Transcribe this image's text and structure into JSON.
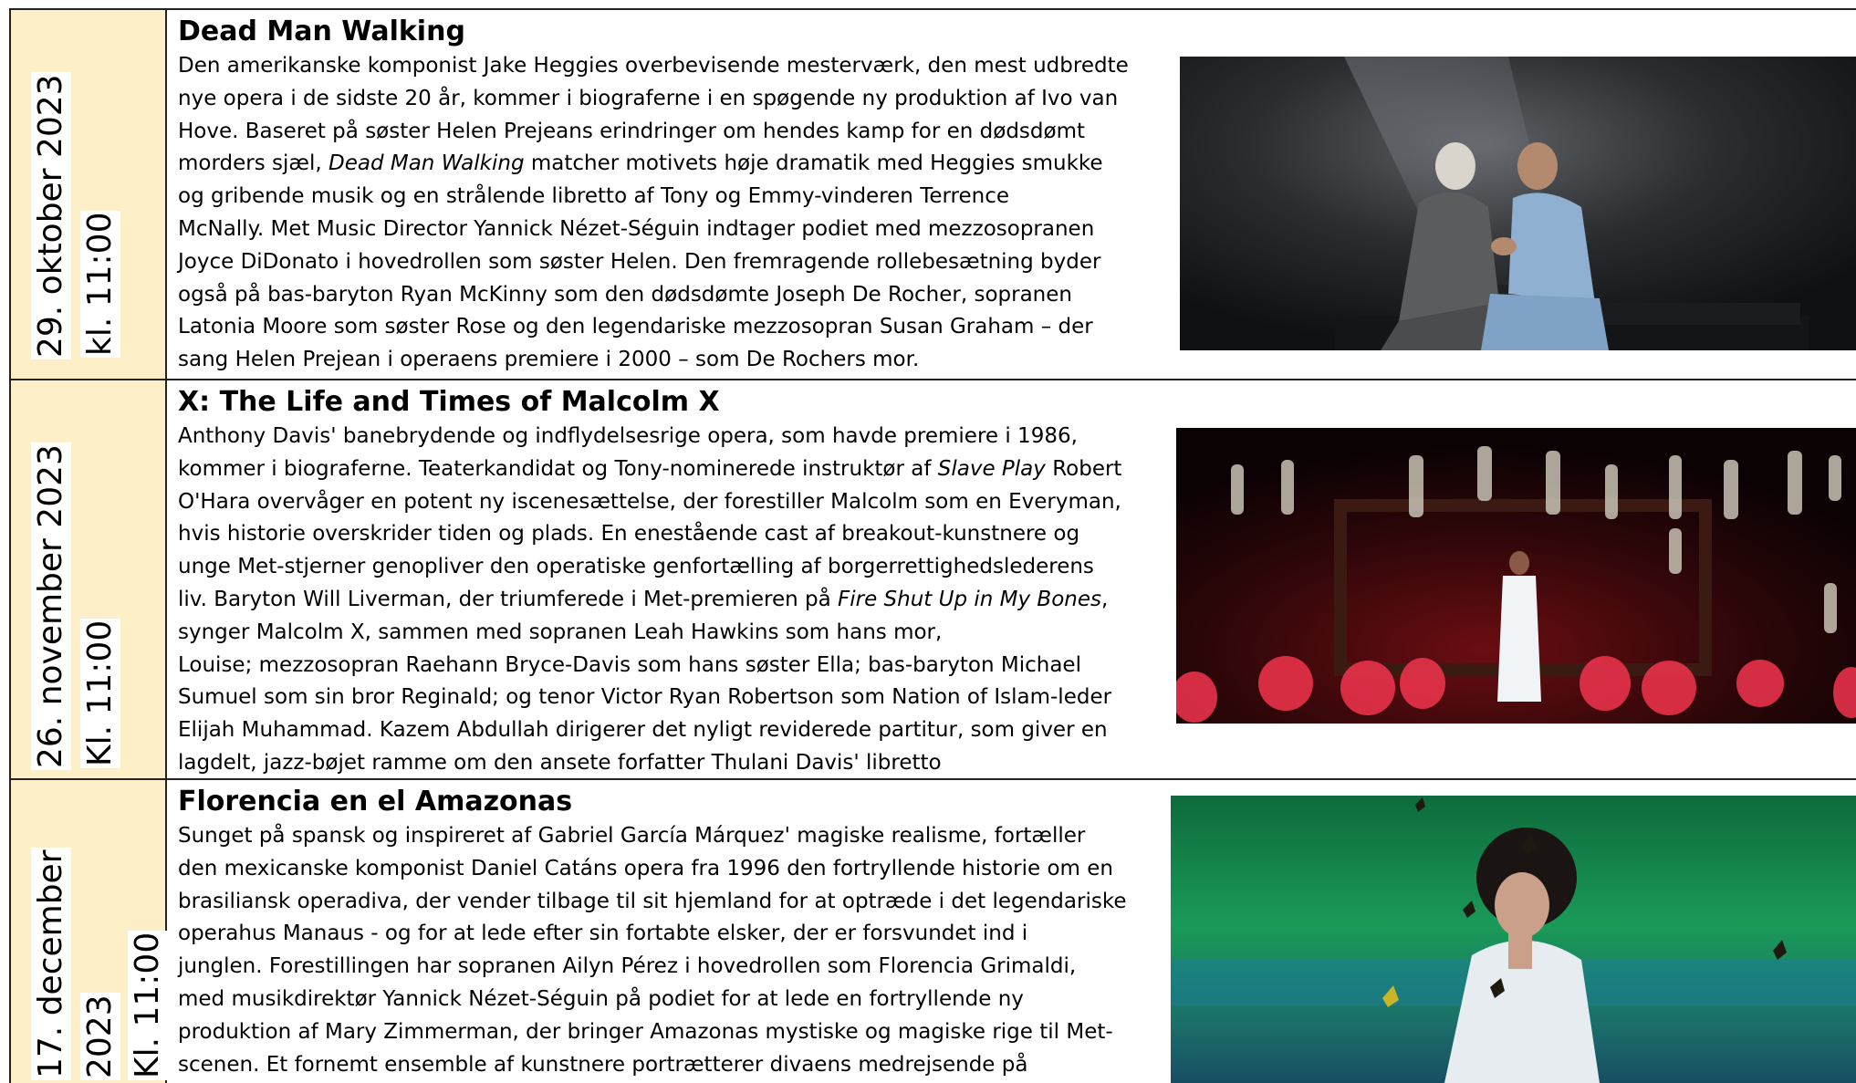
{
  "events": [
    {
      "date": "29. oktober  2023",
      "time": "kl. 11:00",
      "title": "Dead Man Walking",
      "description_lines": [
        "Den amerikanske komponist Jake Heggies overbevisende mesterværk, den mest udbredte",
        "nye opera i de sidste 20 år, kommer i biograferne  i en spøgende ny produktion af Ivo van",
        "Hove. Baseret på søster Helen Prejeans erindringer om hendes kamp for en dødsdømt",
        [
          "morders sjæl, ",
          "Dead Man Walking",
          " matcher motivets høje dramatik med Heggies smukke"
        ],
        "og gribende musik og en strålende libretto af Tony og Emmy-vinderen Terrence",
        "McNally. Met Music Director Yannick Nézet-Séguin indtager podiet med mezzosopranen",
        "Joyce DiDonato i hovedrollen som søster Helen. Den fremragende rollebesætning byder",
        "også på bas-baryton Ryan McKinny som den dødsdømte Joseph De Rocher, sopranen",
        "Latonia Moore som søster Rose og den legendariske mezzosopran Susan Graham – der",
        "sang Helen Prejean i operaens premiere i 2000 – som De Rochers mor."
      ],
      "image_description": "production-photo-dead-man-walking"
    },
    {
      "date": "26. november 2023",
      "time": "Kl. 11:00",
      "title": "X: The Life and Times of Malcolm X",
      "description_lines": [
        "Anthony Davis' banebrydende og indflydelsesrige opera, som havde premiere i 1986,",
        [
          "kommer i biograferne. Teaterkandidat og Tony-nominerede instruktør af ",
          "Slave Play",
          " Robert"
        ],
        "O'Hara overvåger en potent ny iscenesættelse, der forestiller Malcolm som en Everyman,",
        "hvis historie overskrider tiden og plads. En enestående cast af breakout-kunstnere og",
        "unge Met-stjerner genopliver den operatiske genfortælling af borgerrettighedslederens",
        [
          "liv. Baryton Will Liverman, der triumferede i Met-premieren på ",
          "Fire Shut Up in My Bones",
          ","
        ],
        "synger Malcolm X, sammen med sopranen Leah Hawkins som hans mor,",
        "Louise; mezzosopran Raehann Bryce-Davis som hans søster Ella; bas-baryton Michael",
        "Sumuel som sin bror Reginald; og tenor Victor Ryan Robertson som Nation of Islam-leder",
        "Elijah Muhammad. Kazem Abdullah dirigerer det nyligt reviderede partitur, som giver en",
        "lagdelt, jazz-bøjet ramme om den ansete forfatter Thulani Davis' libretto"
      ],
      "image_description": "production-photo-malcolm-x"
    },
    {
      "date_line1": "17. december",
      "date_line2": "2023",
      "time": "Kl.  11:00",
      "title": "Florencia en el Amazonas",
      "description_lines": [
        "Sunget på spansk og inspireret af Gabriel García Márquez' magiske realisme, fortæller",
        "den mexicanske komponist Daniel Catáns opera fra 1996 den fortryllende historie om en",
        "brasiliansk operadiva, der vender tilbage til sit hjemland for at optræde i det legendariske",
        "operahus Manaus - og for at lede efter sin fortabte elsker, der er forsvundet ind i",
        "junglen. Forestillingen har sopranen Ailyn Pérez i hovedrollen som Florencia Grimaldi,",
        "med musikdirektør Yannick Nézet-Séguin på podiet for at lede en fortryllende ny",
        "produktion af Mary Zimmerman, der bringer Amazonas mystiske og magiske rige til Met-",
        "scenen. Et fornemt ensemble af kunstnere portrætterer  divaens medrejsende på"
      ],
      "image_description": "production-photo-florencia"
    }
  ]
}
